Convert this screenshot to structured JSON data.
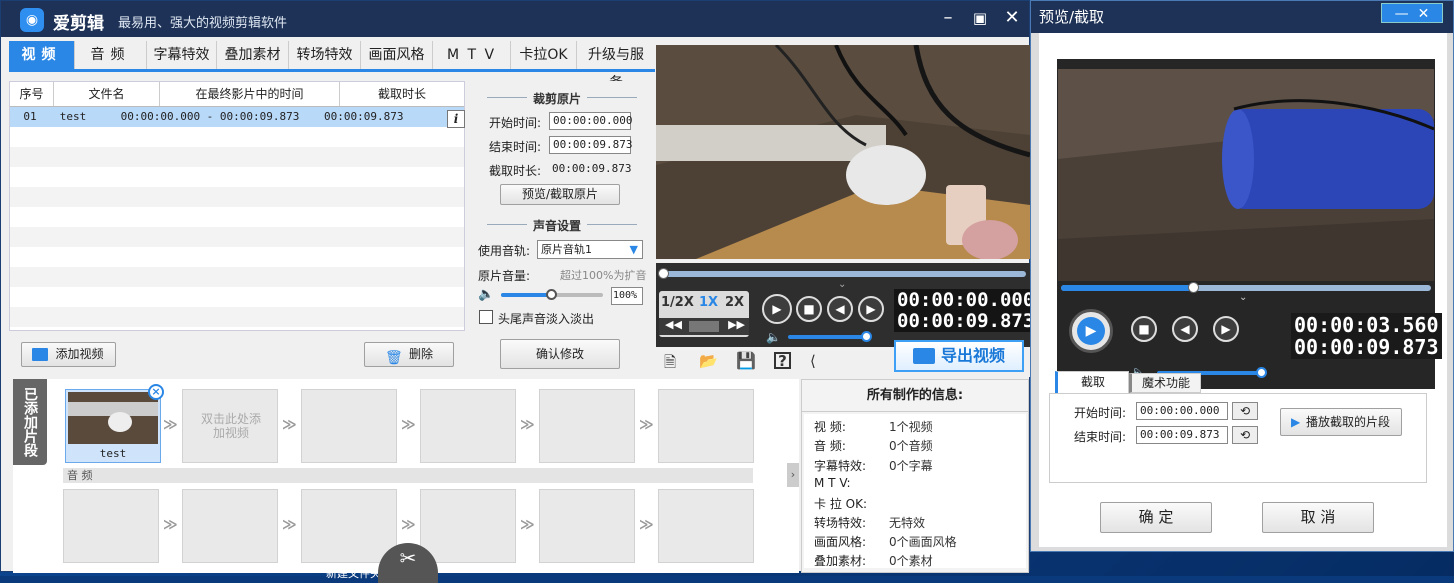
{
  "app": {
    "name": "爱剪辑",
    "slogan": "最易用、强大的视频剪辑软件"
  },
  "tabs": [
    "视频",
    "音频",
    "字幕特效",
    "叠加素材",
    "转场特效",
    "画面风格",
    "M T V",
    "卡拉OK",
    "升级与服务"
  ],
  "table": {
    "headers": [
      "序号",
      "文件名",
      "在最终影片中的时间",
      "截取时长"
    ],
    "rows": [
      {
        "index": "01",
        "name": "test",
        "range": "00:00:00.000 - 00:00:09.873",
        "duration": "00:00:09.873"
      }
    ]
  },
  "buttons": {
    "add_video": "添加视频",
    "delete": "删除",
    "preview_cut": "预览/截取原片",
    "confirm": "确认修改",
    "export": "导出视频"
  },
  "cut": {
    "title": "裁剪原片",
    "start_label": "开始时间:",
    "start": "00:00:00.000",
    "end_label": "结束时间:",
    "end": "00:00:09.873",
    "dur_label": "截取时长:",
    "dur": "00:00:09.873"
  },
  "sound": {
    "title": "声音设置",
    "track_label": "使用音轨:",
    "track": "原片音轨1",
    "vol_label": "原片音量:",
    "vol_hint": "超过100%为扩音",
    "vol_value": "100%",
    "volume_level": 0.5,
    "fade_label": "头尾声音淡入淡出"
  },
  "player": {
    "speeds": [
      "1/2X",
      "1X",
      "2X"
    ],
    "time_current": "00:00:00.000",
    "time_total": "00:00:09.873",
    "progress": 0.0
  },
  "timeline": {
    "side_label": "已添加片段",
    "clip_name": "test",
    "empty_hint": "双击此处添加视频",
    "audio_label": "音 频",
    "remove": "×"
  },
  "info": {
    "title": "所有制作的信息:",
    "rows": [
      {
        "k": "视 频:",
        "v": "1个视频"
      },
      {
        "k": "音 频:",
        "v": "0个音频"
      },
      {
        "k": "字幕特效:",
        "v": "0个字幕"
      },
      {
        "k": "M T V:",
        "v": ""
      },
      {
        "k": "卡 拉 OK:",
        "v": ""
      },
      {
        "k": "转场特效:",
        "v": "无特效"
      },
      {
        "k": "画面风格:",
        "v": "0个画面风格"
      },
      {
        "k": "叠加素材:",
        "v": "0个素材"
      }
    ]
  },
  "preview": {
    "title": "预览/截取",
    "time_current": "00:00:03.560",
    "time_total": "00:00:09.873",
    "progress": 0.36,
    "tabs": [
      "截取",
      "魔术功能"
    ],
    "start_label": "开始时间:",
    "start": "00:00:00.000",
    "end_label": "结束时间:",
    "end": "00:00:09.873",
    "play_cut": "播放截取的片段",
    "ok": "确 定",
    "cancel": "取 消"
  },
  "desktop": {
    "label": "新建文件夹"
  },
  "colors": {
    "accent": "#2a87e6",
    "titlebar": "#1d3256"
  }
}
